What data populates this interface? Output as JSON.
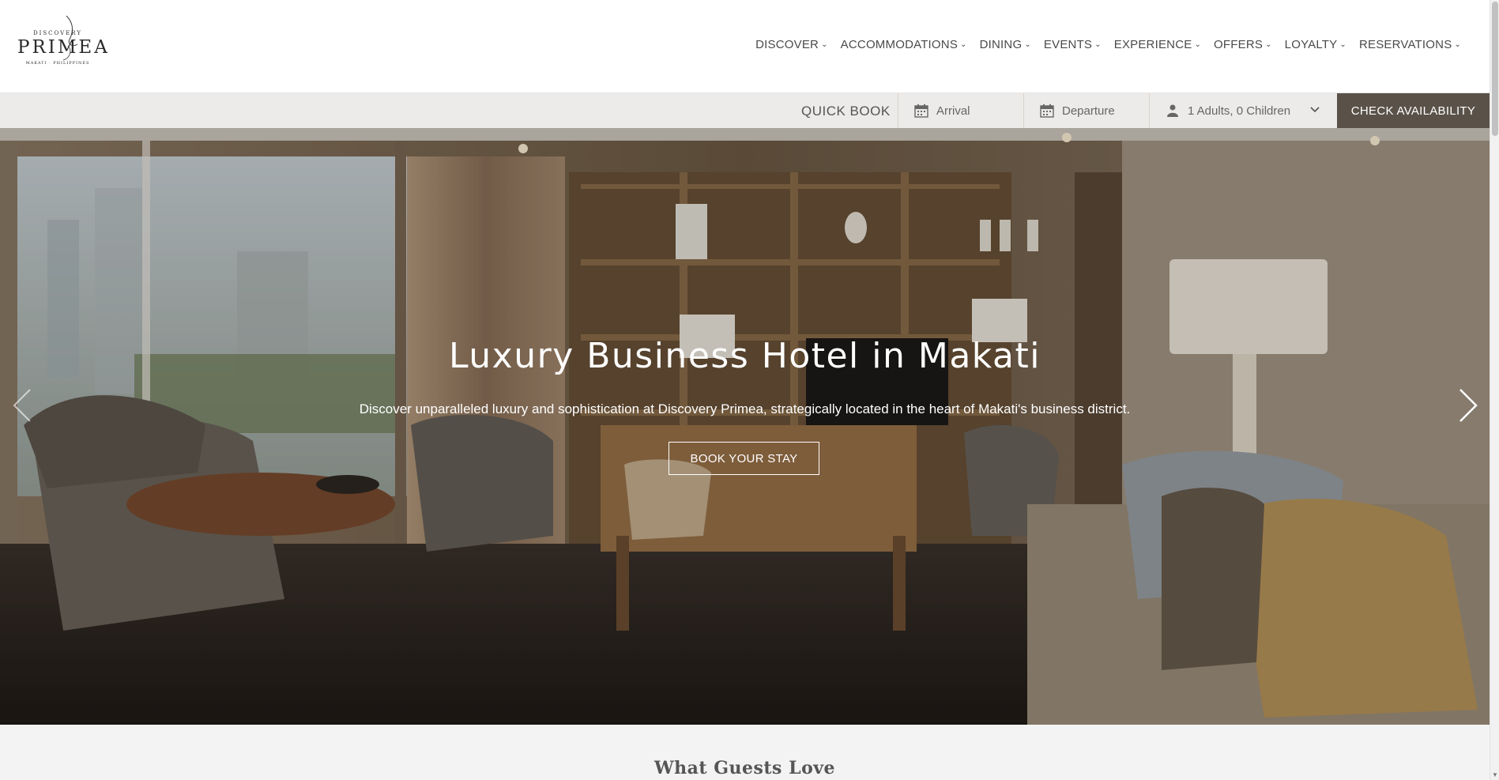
{
  "brand": {
    "top": "DISCOVERY",
    "name": "PRIMEA",
    "location": "MAKATI · PHILIPPINES"
  },
  "nav": {
    "items": [
      {
        "label": "DISCOVER"
      },
      {
        "label": "ACCOMMODATIONS"
      },
      {
        "label": "DINING"
      },
      {
        "label": "EVENTS"
      },
      {
        "label": "EXPERIENCE"
      },
      {
        "label": "OFFERS"
      },
      {
        "label": "LOYALTY"
      },
      {
        "label": "RESERVATIONS"
      }
    ]
  },
  "quickbook": {
    "label": "QUICK BOOK",
    "arrival_placeholder": "Arrival",
    "departure_placeholder": "Departure",
    "guests_value": "1 Adults, 0 Children",
    "check_label": "CHECK AVAILABILITY"
  },
  "hero": {
    "title": "Luxury Business Hotel in Makati",
    "subtitle": "Discover unparalleled luxury and sophistication at Discovery Primea, strategically located in the heart of Makati's business district.",
    "cta": "BOOK YOUR STAY"
  },
  "section": {
    "title": "What Guests Love"
  },
  "colors": {
    "accent": "#5a5148",
    "text": "#4a4a4a"
  }
}
